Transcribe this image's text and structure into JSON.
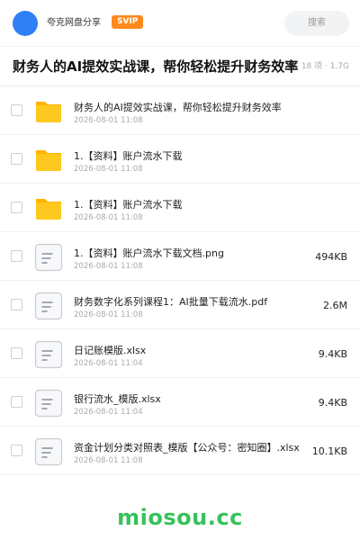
{
  "header": {
    "site_name": "夸克网盘分享",
    "badge": "SVIP",
    "search_placeholder": "搜索",
    "avatar_color": "#2f80f5",
    "badge_color": "#ff8a1f"
  },
  "folder": {
    "title": "财务人的AI提效实战课，帮你轻松提升财务效率",
    "summary": "共 18 项 · 1.7G"
  },
  "files": [
    {
      "type": "folder",
      "name": "财务人的AI提效实战课，帮你轻松提升财务效率",
      "date": "2026-08-01 11:08",
      "size": ""
    },
    {
      "type": "folder",
      "name": "1.【资料】账户流水下载",
      "date": "2026-08-01 11:08",
      "size": ""
    },
    {
      "type": "folder",
      "name": "1.【资料】账户流水下载",
      "date": "2026-08-01 11:08",
      "size": ""
    },
    {
      "type": "file",
      "name": "1.【资料】账户流水下载文档.png",
      "date": "2026-08-01 11:08",
      "size": "494KB"
    },
    {
      "type": "file",
      "name": "财务数字化系列课程1：AI批量下载流水.pdf",
      "date": "2026-08-01 11:08",
      "size": "2.6M"
    },
    {
      "type": "file",
      "name": "日记账模版.xlsx",
      "date": "2026-08-01 11:04",
      "size": "9.4KB"
    },
    {
      "type": "file",
      "name": "银行流水_模版.xlsx",
      "date": "2026-08-01 11:04",
      "size": "9.4KB"
    },
    {
      "type": "file",
      "name": "资金计划分类对照表_模版【公众号：密知圈】.xlsx",
      "date": "2026-08-01 11:08",
      "size": "10.1KB"
    }
  ],
  "watermark": "miosou.cc",
  "colors": {
    "folder_yellow": "#ffc81f",
    "folder_tab": "#ffb400",
    "doc_border": "#c9ccd1",
    "watermark_green": "#37c25b"
  }
}
